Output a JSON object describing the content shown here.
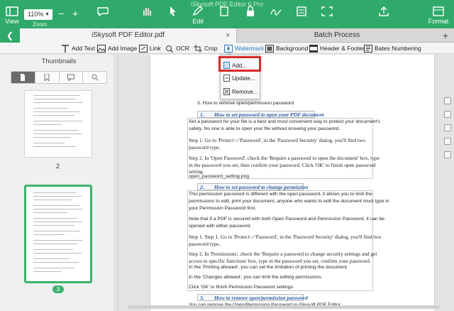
{
  "window": {
    "title": "iSkysoft PDF Editor 6 Pro"
  },
  "toolbar": {
    "view_label": "View",
    "zoom_value": "110%",
    "zoom_label": "Zoom",
    "zoom_out": "−",
    "zoom_in": "+",
    "edit_label": "Edit",
    "format_label": "Format"
  },
  "tabs": {
    "document": "iSkysoft PDF Editor.pdf",
    "close": "×",
    "batch": "Batch Process",
    "add": "+"
  },
  "edit_toolbar": [
    {
      "label": "Add Text",
      "icon": "text-tool-icon"
    },
    {
      "label": "Add Image",
      "icon": "image-icon"
    },
    {
      "label": "Link",
      "icon": "link-icon"
    },
    {
      "label": "OCR",
      "icon": "ocr-icon"
    },
    {
      "label": "Crop",
      "icon": "crop-icon"
    },
    {
      "label": "Watermark",
      "icon": "watermark-icon"
    },
    {
      "label": "Background",
      "icon": "background-icon"
    },
    {
      "label": "Header & Footer",
      "icon": "header-footer-icon"
    },
    {
      "label": "Bates Numbering",
      "icon": "bates-numbering-icon"
    }
  ],
  "sidebar": {
    "title": "Thumbnails",
    "page_2_label": "2",
    "page_3_label": "3"
  },
  "dropdown": {
    "add": "Add...",
    "update": "Update...",
    "remove": "Remove..."
  },
  "document": {
    "step3": "3.     How to remove open/permission password",
    "sec1_num": "1.",
    "sec1_title": "How to set password to open your PDF document",
    "sec1_p1a": "Set a password for your file is a best and most convenient way to protect your document's",
    "sec1_p1b": "safety. No one is able to open your file without knowing your password.",
    "sec1_s1a": "Step 1. Go to 'Protect'->'Password', in the 'Password Security' dialog, you'll find two",
    "sec1_s1b": "password type.",
    "sec1_s2a": "Step 2. In 'Open Password', check the 'Require a password to open the document' box, type",
    "sec1_s2b": "in the password you set, then confirm your password. Click 'OK' to finish open password",
    "sec1_s2c": "setting.",
    "sec1_file": "open_password_setting.png",
    "sec2_num": "2.",
    "sec2_title": "How to set password to change permission",
    "sec2_p1a": "This permission password is different with the open password, it allows you to limit the",
    "sec2_p1b": "permissions to edit, print your document, anyone who wants to edit the document must type in",
    "sec2_p1c": "your Permission Password first.",
    "sec2_p2a": "Note that if a PDF is secured with both Open Password and Permission Password, it can be",
    "sec2_p2b": "opened with either password.",
    "sec2_s1a": "Step 1. Step 1. Go to 'Protect'->'Password', in the 'Password Security' dialog, you'll find two",
    "sec2_s1b": "password type.",
    "sec2_s2a": "Step 2. In 'Permissions', check the 'Require a password to change security settings and get",
    "sec2_s2b": "access to specific functions' box, type in the password you set, confirm your password.",
    "sec2_s2c": "In the 'Printing allowed', you can set the limitation of printing the document.",
    "sec2_changes": "In the 'Changes allowed', you can limit the editing permissions.",
    "sec2_ok": "Click 'OK' to finish Permission Password settings.",
    "sec3_num": "3.",
    "sec3_title": "How to remove open/permission password",
    "sec3_p1": "You can remove the Open/Permission Password in iSkysoft PDF Editor"
  },
  "colors": {
    "accent": "#2faa6a",
    "highlight": "#d72a2a",
    "heading": "#2f5e9c"
  }
}
